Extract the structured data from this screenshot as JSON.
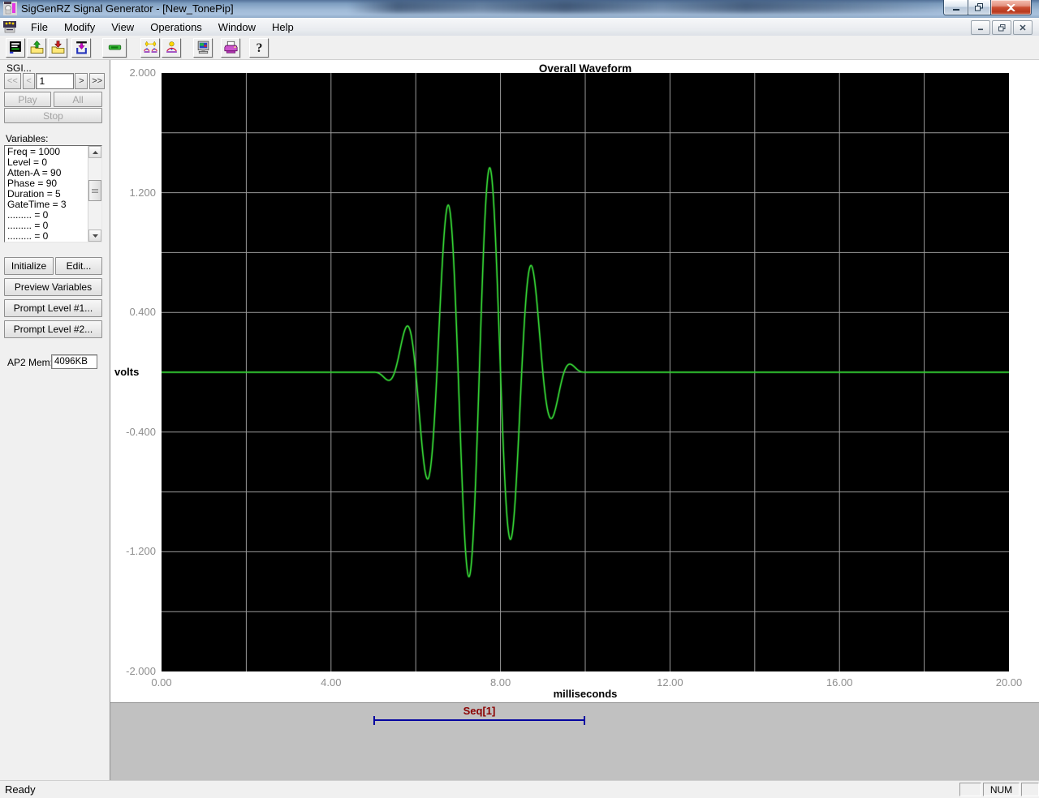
{
  "window": {
    "title": "SigGenRZ Signal Generator - [New_TonePip]"
  },
  "menu": {
    "items": [
      "File",
      "Modify",
      "View",
      "Operations",
      "Window",
      "Help"
    ]
  },
  "toolbar": {
    "buttons": [
      {
        "name": "waveform-display",
        "gap": 0
      },
      {
        "name": "open-signal",
        "gap": 2
      },
      {
        "name": "save-signal",
        "gap": 2
      },
      {
        "name": "load-device",
        "gap": 5
      },
      {
        "name": "button-widget",
        "gap": 14,
        "wide": true
      },
      {
        "name": "view-all-segments",
        "gap": 17
      },
      {
        "name": "view-segment",
        "gap": 2
      },
      {
        "name": "hardware-setup",
        "gap": 15
      },
      {
        "name": "print",
        "gap": 10
      },
      {
        "name": "help-about",
        "gap": 11
      }
    ]
  },
  "sidebar": {
    "sgi_label": "SGI...",
    "nav": {
      "first": "<<",
      "prev": "<",
      "value": "1",
      "next": ">",
      "last": ">>"
    },
    "play_label": "Play",
    "all_label": "All",
    "stop_label": "Stop",
    "variables_label": "Variables:",
    "variables": [
      "Freq = 1000",
      "Level = 0",
      "Atten-A = 90",
      "Phase = 90",
      "Duration = 5",
      "GateTime = 3",
      "......... = 0",
      "......... = 0",
      "......... = 0"
    ],
    "buttons": {
      "initialize": "Initialize",
      "edit": "Edit...",
      "preview": "Preview Variables",
      "prompt1": "Prompt Level #1...",
      "prompt2": "Prompt Level #2..."
    },
    "ap2_mem_label": "AP2 Mem:",
    "ap2_mem_value": "4096KB"
  },
  "chart_data": {
    "type": "line",
    "title": "Overall Waveform",
    "xlabel": "milliseconds",
    "ylabel": "volts",
    "xlim": [
      0,
      20
    ],
    "ylim": [
      -2,
      2
    ],
    "x_ticks": [
      0,
      4,
      8,
      12,
      16,
      20
    ],
    "x_tick_labels": [
      "0.00",
      "4.00",
      "8.00",
      "12.00",
      "16.00",
      "20.00"
    ],
    "y_ticks": [
      2.0,
      1.2,
      0.4,
      -0.4,
      -1.2,
      -2.0
    ],
    "y_tick_labels": [
      "2.000",
      "1.200",
      "0.400",
      "-0.400",
      "-1.200",
      "-2.000"
    ],
    "grid_step_x_ms": 2,
    "grid_step_y_v": 0.4,
    "grid_on": true,
    "background": "#000000",
    "grid_color": "#9a9a9a",
    "line_color": "#33cc33",
    "signal": {
      "description": "1 kHz tone pip, Hann-gated burst on zero baseline",
      "freq_hz": 1000,
      "phase_deg": 90,
      "start_ms": 5,
      "duration_ms": 5,
      "gate_time_ms": 3,
      "peak_amplitude_v": 1.4,
      "envelope": "hann",
      "extrema": [
        {
          "t_ms": 5.25,
          "v": -0.04
        },
        {
          "t_ms": 5.78,
          "v": 0.32
        },
        {
          "t_ms": 6.27,
          "v": -0.71
        },
        {
          "t_ms": 6.78,
          "v": 1.13
        },
        {
          "t_ms": 7.26,
          "v": -1.37
        },
        {
          "t_ms": 7.75,
          "v": 1.36
        },
        {
          "t_ms": 8.24,
          "v": -1.1
        },
        {
          "t_ms": 8.74,
          "v": 0.69
        },
        {
          "t_ms": 9.23,
          "v": -0.29
        },
        {
          "t_ms": 9.66,
          "v": 0.05
        }
      ]
    }
  },
  "seq_band": {
    "label": "Seq[1]",
    "start_ms": 5,
    "end_ms": 10,
    "line_color": "#0000a0",
    "label_color": "#8b0000"
  },
  "status_bar": {
    "ready": "Ready",
    "num": "NUM"
  }
}
